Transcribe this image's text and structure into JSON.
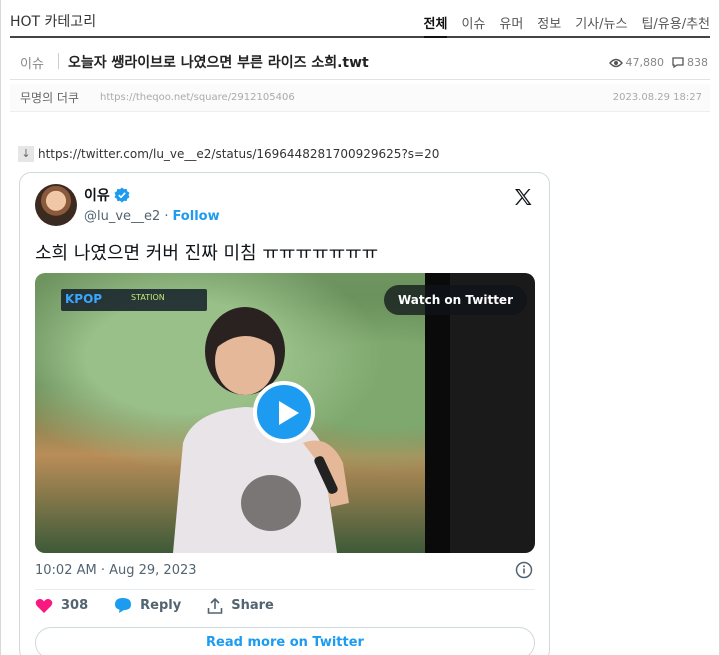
{
  "category": {
    "title": "HOT 카테고리",
    "nav": [
      "전체",
      "이슈",
      "유머",
      "정보",
      "기사/뉴스",
      "팁/유용/추천"
    ],
    "active_index": 0
  },
  "post": {
    "category_label": "이슈",
    "title": "오늘자 쌩라이브로 나였으면 부른 라이즈 소희.twt",
    "views": "47,880",
    "comments": "838",
    "author": "무명의 더쿠",
    "url": "https://theqoo.net/square/2912105406",
    "date": "2023.08.29 18:27",
    "link": "https://twitter.com/lu_ve__e2/status/1696448281700929625?s=20"
  },
  "tweet": {
    "display_name": "이유",
    "handle": "@lu_ve__e2",
    "follow_label": "Follow",
    "text": "소희 나였으면 커버 진짜 미침 ㅠㅠㅠㅠㅠㅠㅠ",
    "media": {
      "watch_label": "Watch on Twitter",
      "brand": "KPOP",
      "brand_sub": "STATION"
    },
    "timestamp": "10:02 AM · Aug 29, 2023",
    "likes": "308",
    "reply_label": "Reply",
    "share_label": "Share",
    "read_more_label": "Read more on Twitter"
  },
  "colors": {
    "accent": "#1d9bf0",
    "like": "#f91880",
    "text_primary": "#0f1419",
    "text_secondary": "#536471"
  }
}
